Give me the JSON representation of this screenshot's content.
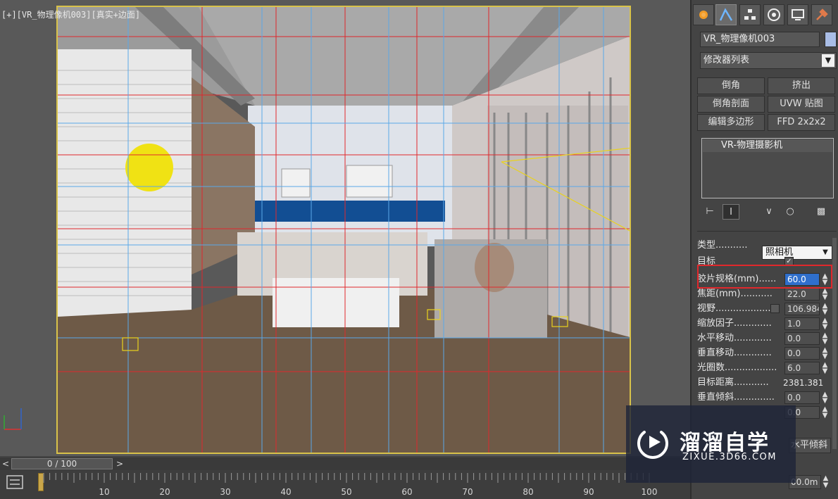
{
  "viewport": {
    "label": "[+][VR_物理像机003][真实+边面]"
  },
  "timeline": {
    "position": "0 / 100",
    "prev_label": "<",
    "next_label": ">",
    "ticks": [
      "10",
      "20",
      "30",
      "40",
      "50",
      "60",
      "70",
      "80",
      "90",
      "100"
    ]
  },
  "command_panel": {
    "tabs": [
      "create-icon",
      "modify-icon",
      "hierarchy-icon",
      "motion-icon",
      "display-icon",
      "utilities-icon"
    ],
    "object_name": "VR_物理像机003",
    "object_color": "#a9bde6",
    "modifier_list": "修改器列表",
    "modifier_buttons": [
      [
        "倒角",
        "挤出"
      ],
      [
        "倒角剖面",
        "UVW 贴图"
      ],
      [
        "编辑多边形",
        "FFD 2x2x2"
      ]
    ],
    "stack_item": "VR-物理摄影机",
    "params": {
      "type_label": "类型...........",
      "type_value": "照相机",
      "target_label": "目标",
      "target_checked": "✓",
      "rows": [
        {
          "label": "胶片规格(mm)......",
          "value": "60.0"
        },
        {
          "label": "焦距(mm)...........",
          "value": "22.0"
        },
        {
          "label": "视野...................",
          "value": "106.984"
        },
        {
          "label": "缩放因子.............",
          "value": "1.0"
        },
        {
          "label": "水平移动.............",
          "value": "0.0"
        },
        {
          "label": "垂直移动.............",
          "value": "0.0"
        },
        {
          "label": "光圈数..................",
          "value": "6.0"
        },
        {
          "label": "目标距离............",
          "value": "2381.381"
        },
        {
          "label": "垂直倾斜..............",
          "value": "0.0"
        },
        {
          "label": "",
          "value": "0.0"
        }
      ],
      "horizontal_tilt_button": "水平倾斜",
      "bottom_value": "00.0m"
    }
  },
  "watermark": {
    "title": "溜溜自学",
    "subtitle": "ZIXUE.3D66.COM"
  },
  "colors": {
    "grid_red": "#e0282c",
    "grid_blue": "#5aa8e8",
    "safe_frame": "#d8c24a",
    "highlight_box": "#e0282c",
    "selected_field": "#2f6fcc"
  }
}
